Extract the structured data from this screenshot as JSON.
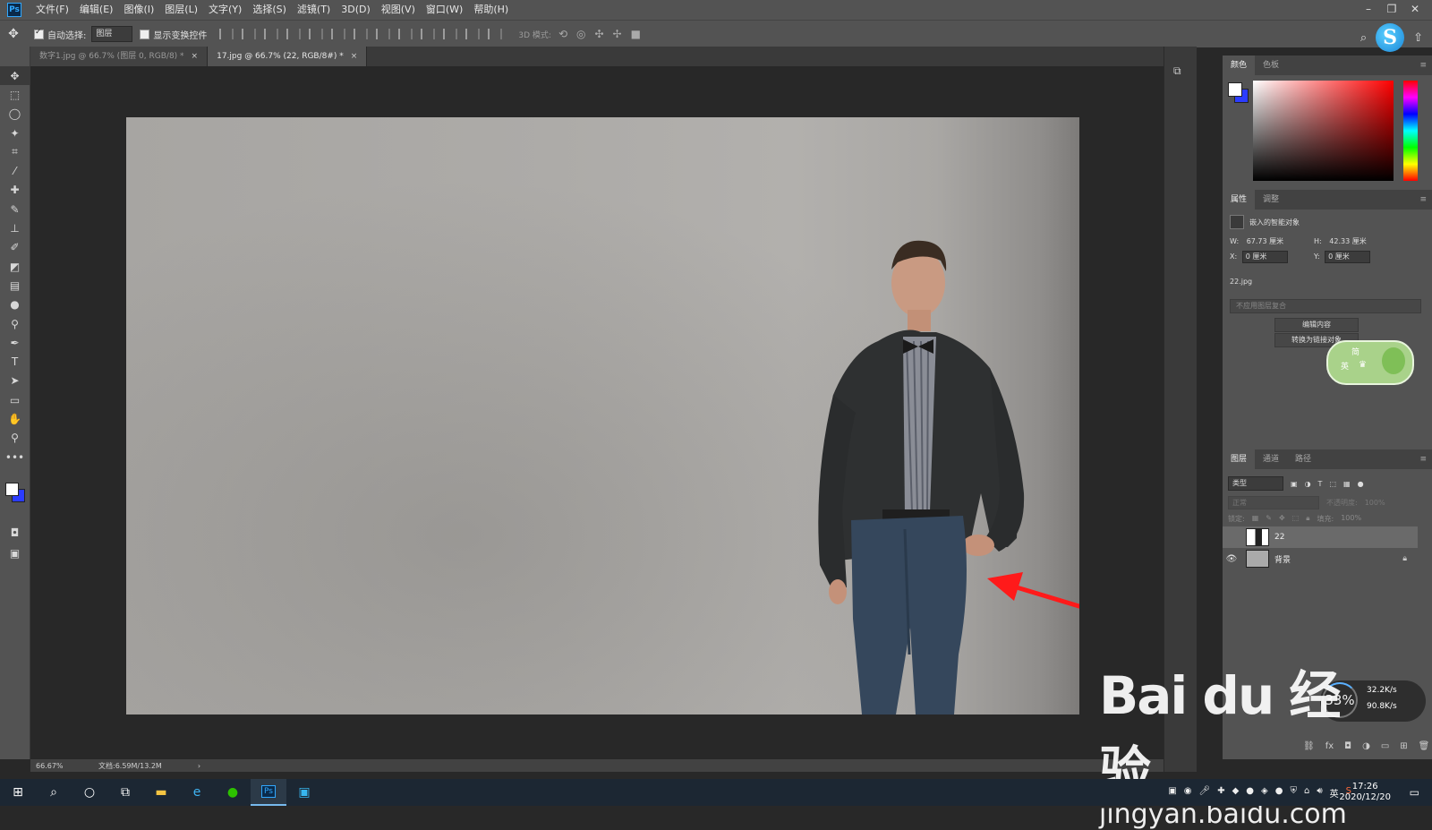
{
  "menu": {
    "items": [
      "文件(F)",
      "编辑(E)",
      "图像(I)",
      "图层(L)",
      "文字(Y)",
      "选择(S)",
      "滤镜(T)",
      "3D(D)",
      "视图(V)",
      "窗口(W)",
      "帮助(H)"
    ],
    "window_buttons": [
      "–",
      "❐",
      "✕"
    ]
  },
  "options": {
    "auto_select_label": "自动选择:",
    "auto_select_value": "图层",
    "show_transform_label": "显示变换控件",
    "mode_3d_label": "3D 模式:"
  },
  "tabs": [
    {
      "label": "数字1.jpg @ 66.7% (图层 0, RGB/8) *",
      "close": "×"
    },
    {
      "label": "17.jpg @ 66.7% (22, RGB/8#) *",
      "close": "×"
    }
  ],
  "status": {
    "zoom": "66.67%",
    "doc": "文档:6.59M/13.2M",
    "arrow": "›"
  },
  "color_panel": {
    "tabs": [
      "颜色",
      "色板"
    ]
  },
  "properties": {
    "tabs": [
      "属性",
      "调整"
    ],
    "type_label": "嵌入的智能对象",
    "w_label": "W:",
    "w_value": "67.73 厘米",
    "h_label": "H:",
    "h_value": "42.33 厘米",
    "x_label": "X:",
    "x_value": "0 厘米",
    "y_label": "Y:",
    "y_value": "0 厘米",
    "filename": "22.jpg",
    "comp_placeholder": "不应用图层复合",
    "edit_button": "编辑内容",
    "convert_button": "转换为链接对象",
    "badge_top": "简",
    "badge_left": "英"
  },
  "layers": {
    "tabs": [
      "图层",
      "通道",
      "路径"
    ],
    "filter_label": "类型",
    "blend": "正常",
    "opacity_label": "不透明度:",
    "opacity_value": "100%",
    "lock_label": "锁定:",
    "fill_label": "填充:",
    "fill_value": "100%",
    "items": [
      {
        "name": "22",
        "visible": false,
        "selected": true
      },
      {
        "name": "背景",
        "visible": true,
        "selected": false,
        "locked": true
      }
    ]
  },
  "speed": {
    "percent": "33%",
    "up": "32.2K/s",
    "down": "90.8K/s"
  },
  "watermark": {
    "brand": "Bai du 经验",
    "url": "jingyan.baidu.com"
  },
  "taskbar": {
    "time": "17:26",
    "date": "2020/12/20",
    "ime": "英"
  }
}
